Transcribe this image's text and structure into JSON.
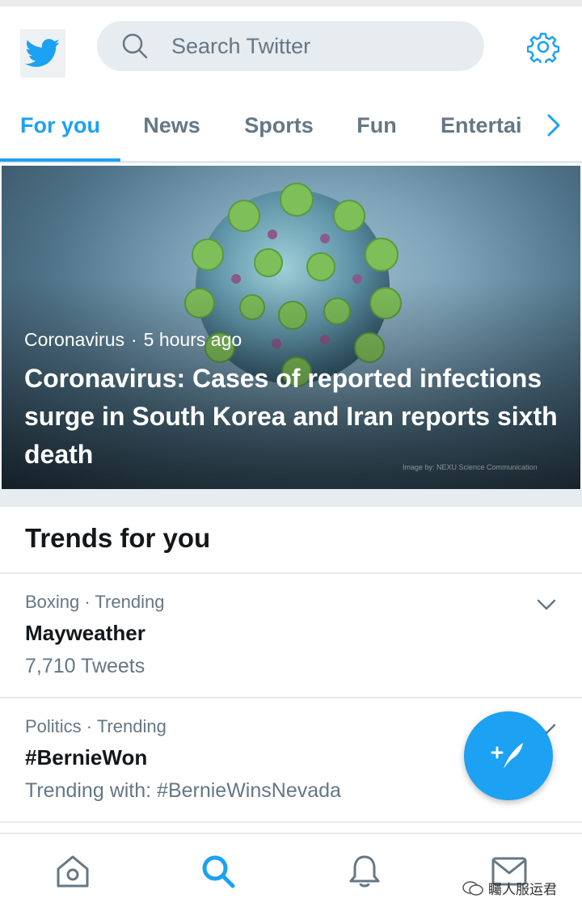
{
  "search": {
    "placeholder": "Search Twitter"
  },
  "tabs": [
    {
      "label": "For you",
      "active": true
    },
    {
      "label": "News",
      "active": false
    },
    {
      "label": "Sports",
      "active": false
    },
    {
      "label": "Fun",
      "active": false
    },
    {
      "label": "Entertai",
      "active": false
    }
  ],
  "hero": {
    "topic": "Coronavirus",
    "time": "5 hours ago",
    "title": "Coronavirus: Cases of reported infections surge in South Korea and Iran reports sixth death",
    "image_credit": "Image by: NEXU Science Communication"
  },
  "trends": {
    "heading": "Trends for you",
    "items": [
      {
        "meta": "Boxing · Trending",
        "name": "Mayweather",
        "sub": "7,710 Tweets"
      },
      {
        "meta": "Politics · Trending",
        "name": "#BernieWon",
        "sub": "Trending with: #BernieWinsNevada"
      }
    ]
  },
  "watermark": "矚人服运君",
  "icons": {
    "logo": "twitter-bird-icon",
    "search": "search-icon",
    "settings": "gear-icon",
    "tab_next": "chevron-right-icon",
    "trend_menu": "chevron-down-icon",
    "compose": "compose-tweet-icon",
    "nav_home": "home-icon",
    "nav_explore": "search-icon",
    "nav_notifications": "bell-icon",
    "nav_messages": "mail-icon"
  },
  "colors": {
    "accent": "#1da1f2",
    "text_primary": "#14171a",
    "text_secondary": "#657786",
    "divider": "#e6ecf0"
  }
}
